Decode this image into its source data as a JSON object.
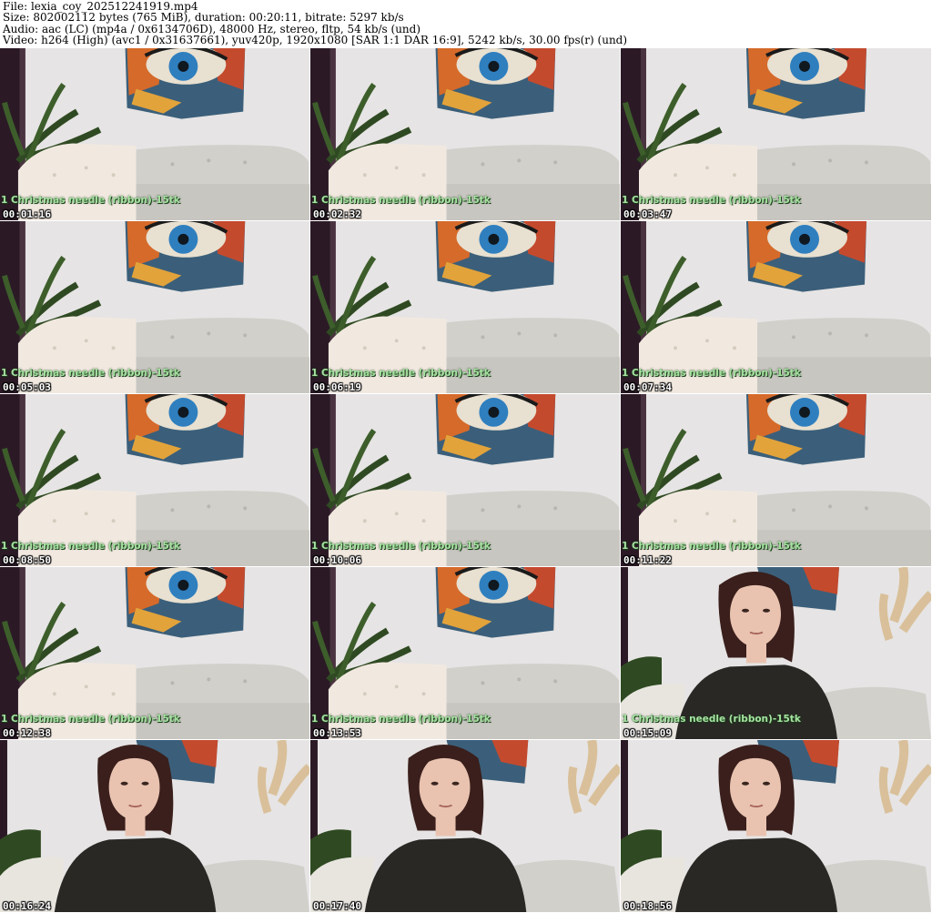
{
  "header": {
    "line1": "File: lexia_coy_202512241919.mp4",
    "line2": "Size: 802002112 bytes (765 MiB), duration: 00:20:11, bitrate: 5297 kb/s",
    "line3": "Audio: aac (LC) (mp4a / 0x6134706D), 48000 Hz, stereo, fltp, 54 kb/s (und)",
    "line4": "Video: h264 (High) (avc1 / 0x31637661), yuv420p, 1920x1080 [SAR 1:1 DAR 16:9], 5242 kb/s, 30.00 fps(r) (und)"
  },
  "thumbnails": [
    {
      "time": "00:01:16",
      "overlay": "1 Christmas needle (ribbon)-15tk",
      "scene": "room"
    },
    {
      "time": "00:02:32",
      "overlay": "1 Christmas needle (ribbon)-15tk",
      "scene": "room"
    },
    {
      "time": "00:03:47",
      "overlay": "1 Christmas needle (ribbon)-15tk",
      "scene": "room"
    },
    {
      "time": "00:05:03",
      "overlay": "1 Christmas needle (ribbon)-15tk",
      "scene": "room"
    },
    {
      "time": "00:06:19",
      "overlay": "1 Christmas needle (ribbon)-15tk",
      "scene": "room"
    },
    {
      "time": "00:07:34",
      "overlay": "1 Christmas needle (ribbon)-15tk",
      "scene": "room"
    },
    {
      "time": "00:08:50",
      "overlay": "1 Christmas needle (ribbon)-15tk",
      "scene": "room"
    },
    {
      "time": "00:10:06",
      "overlay": "1 Christmas needle (ribbon)-15tk",
      "scene": "room"
    },
    {
      "time": "00:11:22",
      "overlay": "1 Christmas needle (ribbon)-15tk",
      "scene": "room"
    },
    {
      "time": "00:12:38",
      "overlay": "1 Christmas needle (ribbon)-15tk",
      "scene": "room"
    },
    {
      "time": "00:13:53",
      "overlay": "1 Christmas needle (ribbon)-15tk",
      "scene": "room"
    },
    {
      "time": "00:15:09",
      "overlay": "1 Christmas needle (ribbon)-15tk",
      "scene": "person"
    },
    {
      "time": "00:16:24",
      "overlay": "",
      "scene": "person"
    },
    {
      "time": "00:17:40",
      "overlay": "",
      "scene": "person"
    },
    {
      "time": "00:18:56",
      "overlay": "",
      "scene": "person"
    }
  ],
  "colors": {
    "wall": "#e6e4e4",
    "curtain": "#2b1a26",
    "sofa": "#d2d0cb",
    "plant": "#2f4a22",
    "overlay_text": "#a6e3a1",
    "timestamp_text": "#ffffff",
    "sweater": "#2a2825",
    "hair": "#3a1f1c",
    "skin": "#e9c3b0",
    "pampas": "#d9c09a"
  }
}
